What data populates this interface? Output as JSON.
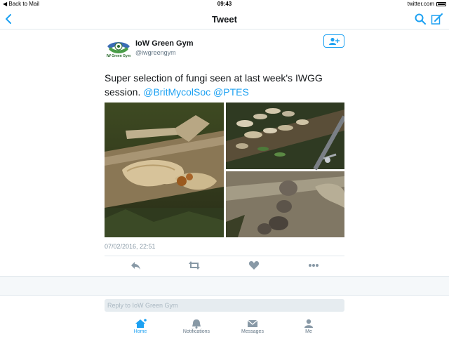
{
  "status_bar": {
    "back_label": "Back to Mail",
    "time": "09:43",
    "site": "twitter.com"
  },
  "nav": {
    "title": "Tweet"
  },
  "tweet": {
    "avatar_text": "IW Green Gym",
    "name": "IoW Green Gym",
    "handle": "@iwgreengym",
    "text_before": "Super selection of fungi seen at last week's IWGG session. ",
    "mention1": "@BritMycolSoc",
    "mention2": "@PTES",
    "timestamp": "07/02/2016, 22:51"
  },
  "reply": {
    "placeholder": "Reply to IoW Green Gym"
  },
  "tabs": [
    {
      "label": "Home",
      "icon": "home-icon",
      "active": true
    },
    {
      "label": "Notifications",
      "icon": "bell-icon",
      "active": false
    },
    {
      "label": "Messages",
      "icon": "envelope-icon",
      "active": false
    },
    {
      "label": "Me",
      "icon": "person-icon",
      "active": false
    }
  ],
  "colors": {
    "accent": "#1da1f2",
    "text": "#14171a",
    "muted": "#657786",
    "band": "#f5f8fa"
  }
}
